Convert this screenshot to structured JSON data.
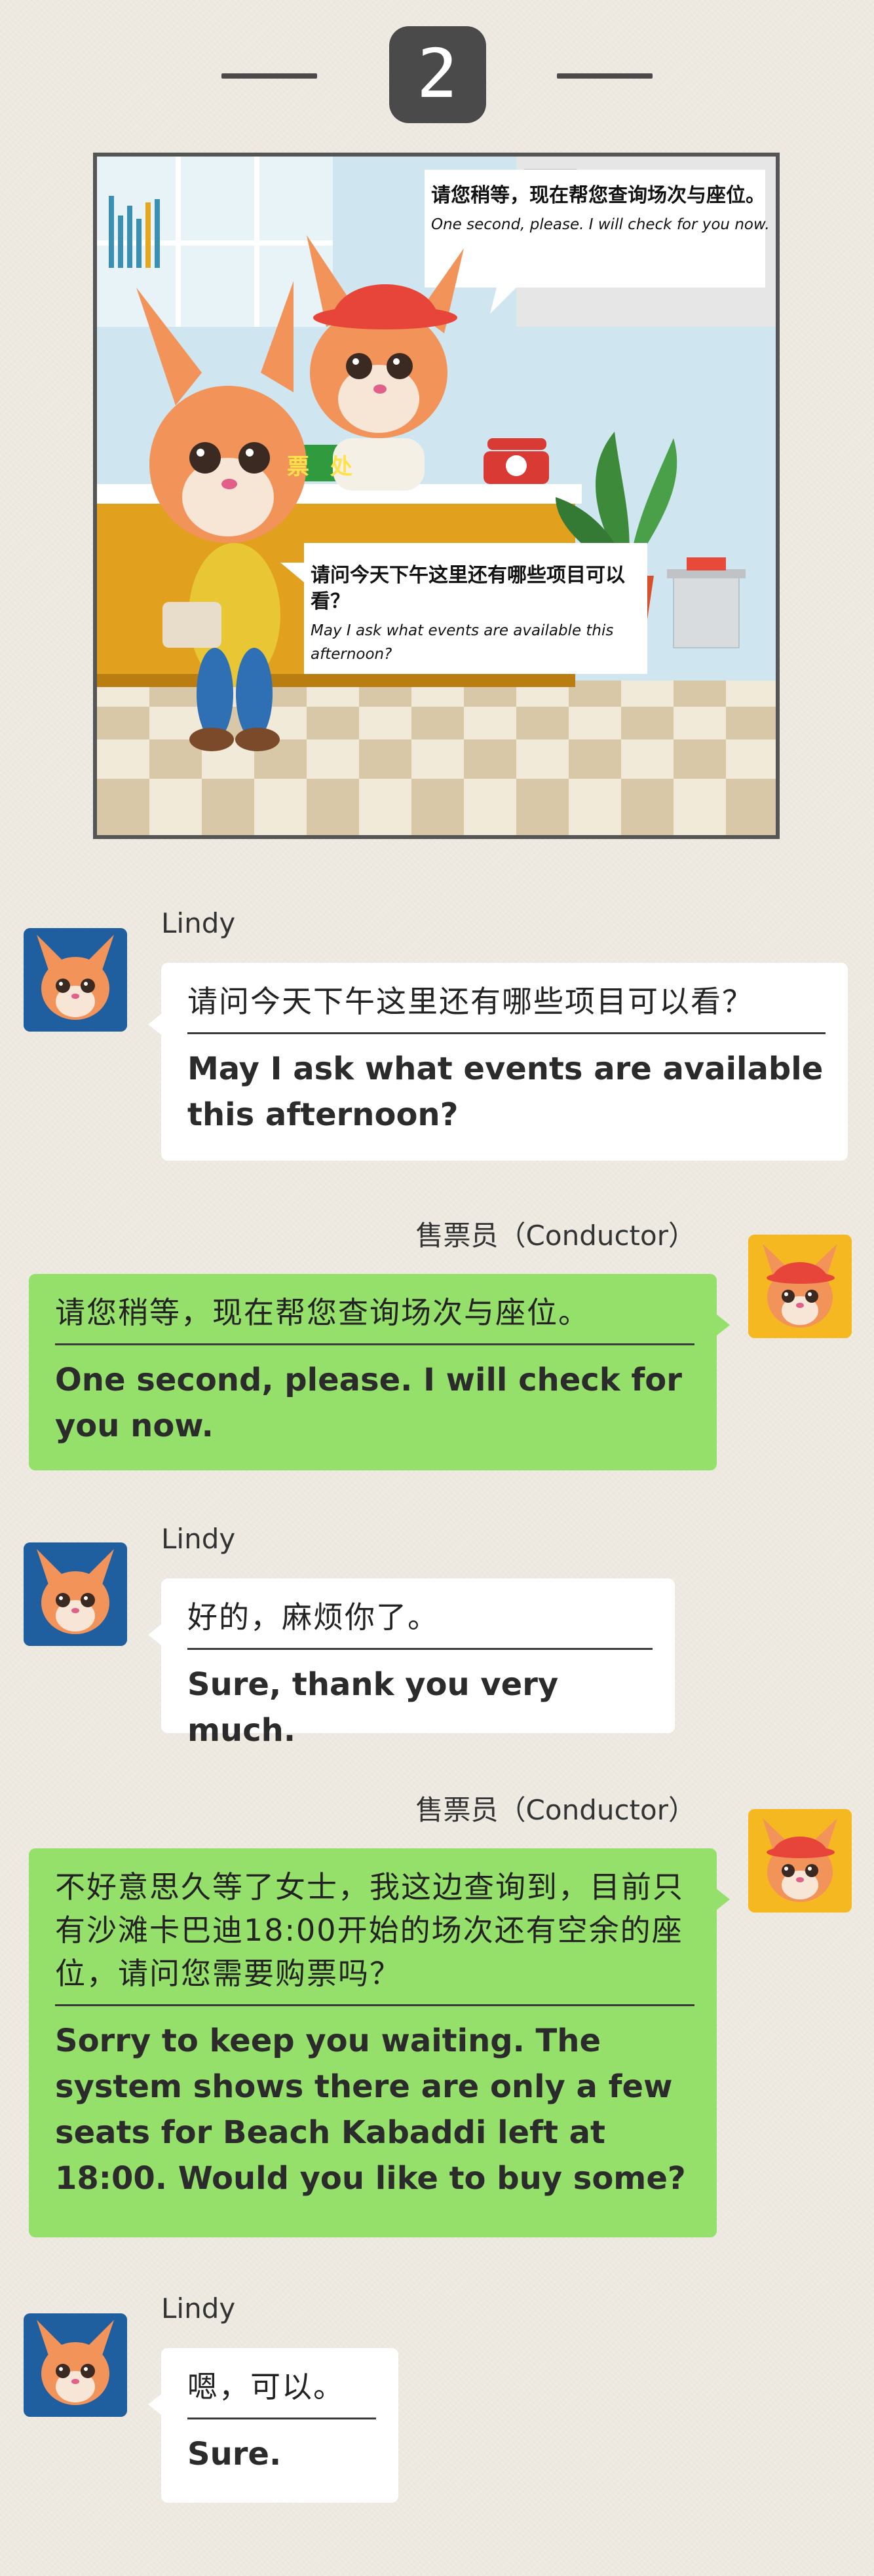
{
  "header": {
    "step_number": "2"
  },
  "illustration": {
    "ticket_sign": "票 处",
    "bubble_top": {
      "zh": "请您稍等，现在帮您查询场次与座位。",
      "en": "One second, please. I will check for you now."
    },
    "bubble_bottom": {
      "zh": "请问今天下午这里还有哪些项目可以看？",
      "en": "May I ask what events are available this afternoon?"
    }
  },
  "messages": [
    {
      "speaker": "Lindy",
      "zh": "请问今天下午这里还有哪些项目可以看？",
      "en": "May I ask what events are available this afternoon?"
    },
    {
      "speaker": "售票员（Conductor）",
      "zh": "请您稍等，现在帮您查询场次与座位。",
      "en": "One second, please. I will check for you now."
    },
    {
      "speaker": "Lindy",
      "zh": "好的，麻烦你了。",
      "en": "Sure, thank you very much."
    },
    {
      "speaker": "售票员（Conductor）",
      "zh": "不好意思久等了女士，我这边查询到，目前只有沙滩卡巴迪18:00开始的场次还有空余的座位，请问您需要购票吗？",
      "en": "Sorry to keep you waiting. The system shows there are only a few seats for Beach Kabaddi left at 18:00. Would you like to buy some?"
    },
    {
      "speaker": "Lindy",
      "zh": "嗯，可以。",
      "en": "Sure."
    }
  ],
  "colors": {
    "page_background": "#efebe3",
    "customer_bubble": "#ffffff",
    "conductor_bubble": "#95e06a",
    "customer_avatar_bg": "#1f5fa0",
    "conductor_avatar_bg": "#f5b820",
    "header_dark": "#4a4a4a"
  }
}
